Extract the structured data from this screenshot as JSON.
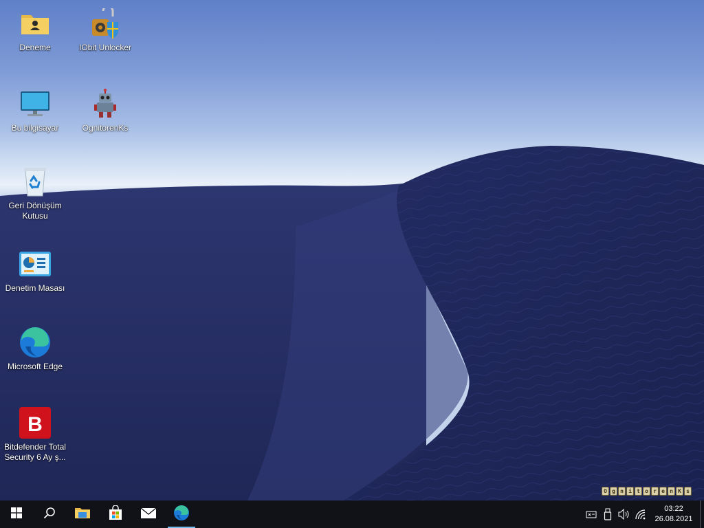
{
  "desktop": {
    "icons": [
      {
        "label": "Deneme",
        "icon": "user-folder-icon"
      },
      {
        "label": "IObit Unlocker",
        "icon": "iobit-unlocker-icon"
      },
      {
        "label": "Bu bilgisayar",
        "icon": "monitor-icon"
      },
      {
        "label": "OgnitorenKs",
        "icon": "robot-icon"
      },
      {
        "label": "Geri Dönüşüm Kutusu",
        "icon": "recycle-bin-icon"
      },
      {
        "label": "Denetim Masası",
        "icon": "control-panel-icon"
      },
      {
        "label": "Microsoft Edge",
        "icon": "edge-icon"
      },
      {
        "label": "Bitdefender Total Security  6 Ay ş...",
        "icon": "bitdefender-icon"
      }
    ],
    "watermark_text": "OgnitorenKs"
  },
  "taskbar": {
    "buttons": [
      {
        "name": "start",
        "icon": "windows-logo-icon"
      },
      {
        "name": "search",
        "icon": "search-icon"
      },
      {
        "name": "file-explorer",
        "icon": "folder-icon"
      },
      {
        "name": "microsoft-store",
        "icon": "store-icon"
      },
      {
        "name": "mail",
        "icon": "mail-icon"
      },
      {
        "name": "edge",
        "icon": "edge-icon",
        "active": true
      }
    ],
    "tray": {
      "icons": [
        "input-indicator-icon",
        "usb-icon",
        "volume-icon",
        "network-icon"
      ],
      "time": "03:22",
      "date": "26.08.2021"
    }
  },
  "colors": {
    "taskbar_bg": "#101218",
    "active_indicator": "#76b9ed",
    "dune_shadow": "#27306a",
    "dune_lit": "#1f2757"
  }
}
